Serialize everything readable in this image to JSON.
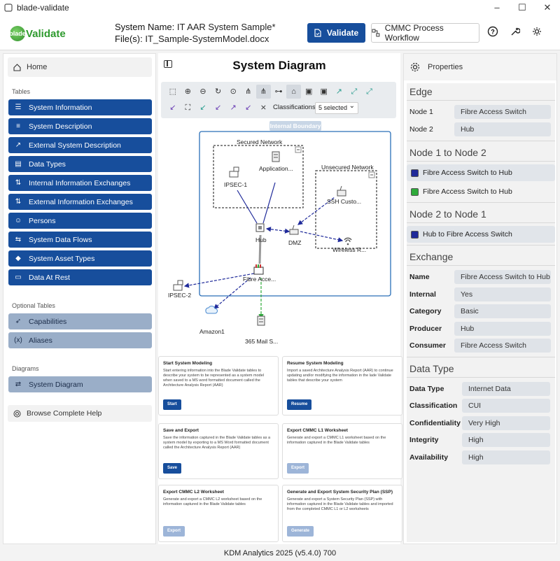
{
  "window": {
    "title": "blade-validate",
    "minimize": "–",
    "maximize": "☐",
    "close": "✕"
  },
  "header": {
    "logo_prefix": "blade",
    "logo_word": "Validate",
    "system_name_label": "System Name:",
    "system_name": "IT AAR System Sample*",
    "files_label": "File(s):",
    "files": "IT_Sample-SystemModel.docx",
    "validate_label": "Validate",
    "cmmc_label": "CMMC Process Workflow"
  },
  "sidebar": {
    "home": "Home",
    "tables_label": "Tables",
    "tables": [
      {
        "label": "System Information",
        "icon": "☰"
      },
      {
        "label": "System Description",
        "icon": "≡"
      },
      {
        "label": "External System Description",
        "icon": "↗"
      },
      {
        "label": "Data Types",
        "icon": "▤"
      },
      {
        "label": "Internal Information Exchanges",
        "icon": "⇅"
      },
      {
        "label": "External Information Exchanges",
        "icon": "⇅"
      },
      {
        "label": "Persons",
        "icon": "☺"
      },
      {
        "label": "System Data Flows",
        "icon": "⇆"
      },
      {
        "label": "System Asset Types",
        "icon": "◆"
      },
      {
        "label": "Data At Rest",
        "icon": "▭"
      }
    ],
    "optional_label": "Optional Tables",
    "optional": [
      {
        "label": "Capabilities",
        "icon": "➶"
      },
      {
        "label": "Aliases",
        "icon": "(x)"
      }
    ],
    "diagrams_label": "Diagrams",
    "diagrams": [
      {
        "label": "System Diagram",
        "icon": "⇄"
      }
    ],
    "help": "Browse Complete Help"
  },
  "center": {
    "title": "System Diagram",
    "classifications_label": "Classifications",
    "classifications_value": "5 selected",
    "diagram": {
      "boundary": "Internal Boundary",
      "secured": "Secured Network",
      "unsecured": "Unsecured Network",
      "nodes": {
        "ipsec1": "IPSEC-1",
        "application": "Application...",
        "hub": "Hub",
        "dmz": "DMZ",
        "ssh": "SSH Custo...",
        "wireless": "Wireless R...",
        "fibre": "Fibre Acce...",
        "ipsec2": "IPSEC-2",
        "amazon": "Amazon1",
        "mail": "365 Mail S..."
      }
    },
    "cards": [
      {
        "title": "Start System Modeling",
        "desc": "Start entering information into the Blade Validate tables to describe your system to be represented as a system model when saved to a MS word formatted document called the Architecture Analysis Report (AAR)",
        "button": "Start",
        "disabled": false
      },
      {
        "title": "Resume System Modeling",
        "desc": "Import a saved Architecture Analysis Report (AAR) to continue updating and/or modifying the information in the lade Validate tables that describe your system",
        "button": "Resume",
        "disabled": false
      },
      {
        "title": "Save and Export",
        "desc": "Save the information captured in the Blade Validate tables as a system model by exporting to a MS Word formatted document called the Architecture Analysis Report (AAR)",
        "button": "Save",
        "disabled": false
      },
      {
        "title": "Export CMMC L1 Worksheet",
        "desc": "Generate and export a CMMC L1 worksheet based on the information captured in the Blade Validate tables",
        "button": "Export",
        "disabled": true
      },
      {
        "title": "Export CMMC L2 Worksheet",
        "desc": "Generate and export a CMMC L2 worksheet based on the information captured in the Blade Validate tables",
        "button": "Export",
        "disabled": true
      },
      {
        "title": "Generate and Export System Security Plan (SSP)",
        "desc": "Generate and export a System Security Plan (SSP) with information captured in the Blade Validate tables and imported from the completed CMMC L1 or L2 worksheets",
        "button": "Generate",
        "disabled": true
      }
    ]
  },
  "properties": {
    "title": "Properties",
    "edge_title": "Edge",
    "edge": [
      {
        "label": "Node 1",
        "value": "Fibre Access Switch"
      },
      {
        "label": "Node 2",
        "value": "Hub"
      }
    ],
    "n1n2_title": "Node 1 to Node 2",
    "n1n2": [
      {
        "label": "Fibre Access Switch to Hub",
        "color": "#1f2a9a"
      },
      {
        "label": "Fibre Access Switch to Hub",
        "color": "#2eaa3a"
      }
    ],
    "n2n1_title": "Node 2 to Node 1",
    "n2n1": [
      {
        "label": "Hub to Fibre Access Switch",
        "color": "#1f2a9a"
      }
    ],
    "exchange_title": "Exchange",
    "exchange": [
      {
        "label": "Name",
        "value": "Fibre Access Switch to Hub"
      },
      {
        "label": "Internal",
        "value": "Yes"
      },
      {
        "label": "Category",
        "value": "Basic"
      },
      {
        "label": "Producer",
        "value": "Hub"
      },
      {
        "label": "Consumer",
        "value": "Fibre Access Switch"
      }
    ],
    "datatype_title": "Data Type",
    "datatype": [
      {
        "label": "Data Type",
        "value": "Internet Data"
      },
      {
        "label": "Classification",
        "value": "CUI"
      },
      {
        "label": "Confidentiality",
        "value": "Very High"
      },
      {
        "label": "Integrity",
        "value": "High"
      },
      {
        "label": "Availability",
        "value": "High"
      }
    ]
  },
  "footer": "KDM Analytics 2025 (v5.4.0) 700"
}
